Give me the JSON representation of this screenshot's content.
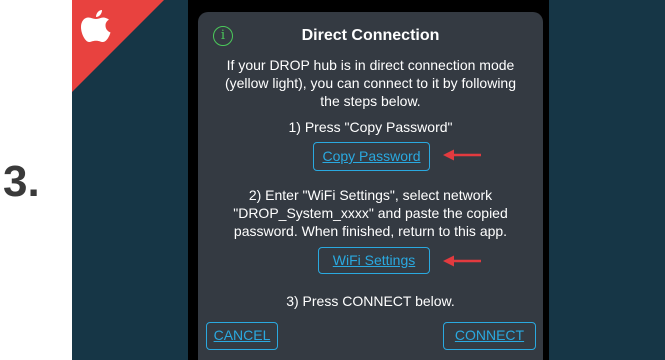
{
  "step": {
    "number": "3."
  },
  "platform": {
    "icon": "apple-icon",
    "badge_color": "#e8423f"
  },
  "dialog": {
    "info_icon": "info-icon",
    "title": "Direct Connection",
    "intro_lines": [
      "If your DROP hub is in direct connection mode",
      "(yellow light), you can connect to it by following",
      "the steps below."
    ],
    "step1": "1) Press \"Copy Password\"",
    "copy_button": "Copy Password",
    "step2_lines": [
      "2) Enter \"WiFi Settings\", select network",
      "\"DROP_System_xxxx\" and paste the copied",
      "password.  When finished, return to this app."
    ],
    "wifi_button": "WiFi Settings",
    "step3": "3) Press CONNECT below.",
    "cancel_button": "CANCEL",
    "connect_button": "CONNECT"
  },
  "colors": {
    "accent_link": "#2aa9e0",
    "info_green": "#4bc95a",
    "annotation_arrow": "#e23a3f",
    "backdrop": "#163646",
    "dialog_bg": "#343a42"
  }
}
